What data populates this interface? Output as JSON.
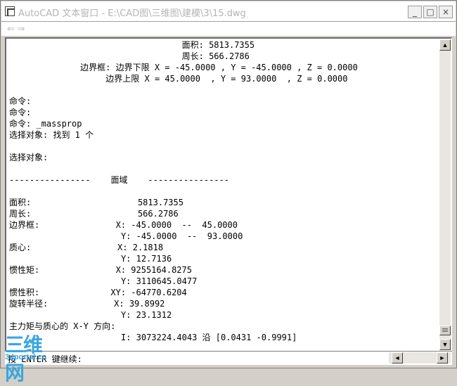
{
  "window": {
    "title": "AutoCAD 文本窗口 - E:\\CAD图\\三维图\\建模\\3\\15.dwg"
  },
  "titlebar_buttons": {
    "minimize": "_",
    "maximize": "□",
    "close": "×"
  },
  "toolbar": {
    "nav_icon": "⇐ ⇒"
  },
  "console_lines": [
    "                                  面积: 5813.7355",
    "                                  周长: 566.2786",
    "              边界框: 边界下限 X = -45.0000 , Y = -45.0000 , Z = 0.0000",
    "                   边界上限 X = 45.0000  , Y = 93.0000  , Z = 0.0000",
    "",
    "命令:",
    "命令:",
    "命令: _massprop",
    "选择对象: 找到 1 个",
    "",
    "选择对象:",
    "",
    "----------------    面域    ----------------",
    "",
    "面积:                     5813.7355",
    "周长:                     566.2786",
    "边界框:               X: -45.0000  --  45.0000",
    "                      Y: -45.0000  --  93.0000",
    "质心:                 X: 2.1818",
    "                      Y: 12.7136",
    "惯性矩:               X: 9255164.8275",
    "                      Y: 3110645.0477",
    "惯性积:              XY: -64770.6204",
    "旋转半径:             X: 39.8992",
    "                      Y: 23.1312",
    "主力矩与质心的 X-Y 方向:",
    "                      I: 3073224.4043 沿 [0.0431 -0.9991]"
  ],
  "command_prompt": "按 ENTER 键继续:",
  "scrollbar": {
    "up": "▲",
    "down": "▼",
    "left": "◄",
    "right": "►"
  },
  "watermark": {
    "logo_text": "三维网",
    "url": "3dportal.cn"
  }
}
